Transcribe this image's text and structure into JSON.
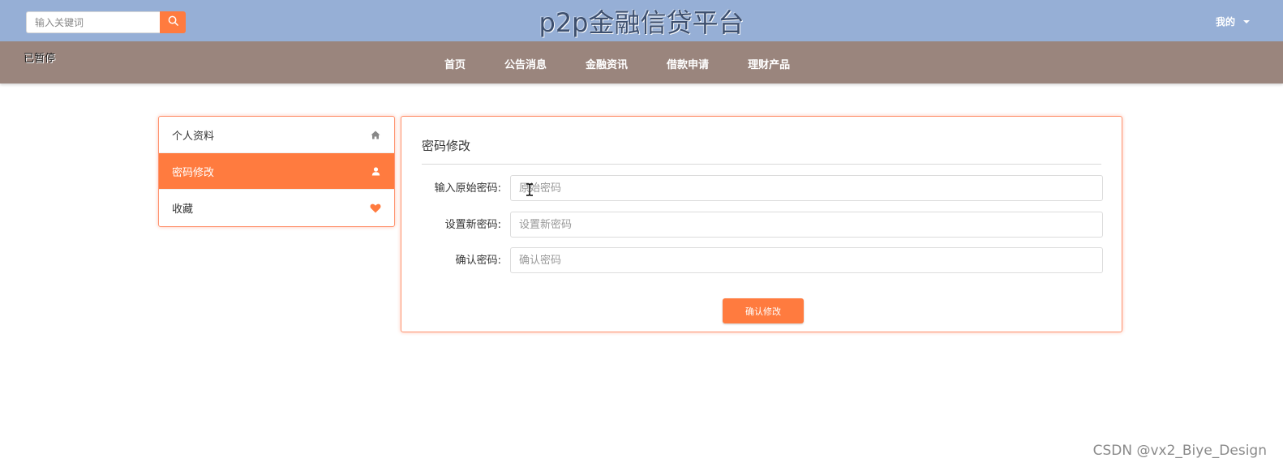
{
  "header": {
    "search_placeholder": "输入关键词",
    "site_title": "p2p金融信贷平台",
    "user_menu_label": "我的"
  },
  "navbar": {
    "paused_label": "已暂停",
    "items": [
      {
        "label": "首页"
      },
      {
        "label": "公告消息"
      },
      {
        "label": "金融资讯"
      },
      {
        "label": "借款申请"
      },
      {
        "label": "理财产品"
      }
    ]
  },
  "sidemenu": {
    "items": [
      {
        "label": "个人资料",
        "icon": "home-icon",
        "active": false
      },
      {
        "label": "密码修改",
        "icon": "user-icon",
        "active": true
      },
      {
        "label": "收藏",
        "icon": "heart-icon",
        "active": false
      }
    ]
  },
  "password_form": {
    "title": "密码修改",
    "fields": [
      {
        "label": "输入原始密码:",
        "placeholder": "原始密码",
        "value": ""
      },
      {
        "label": "设置新密码:",
        "placeholder": "设置新密码",
        "value": ""
      },
      {
        "label": "确认密码:",
        "placeholder": "确认密码",
        "value": ""
      }
    ],
    "submit_label": "确认修改"
  },
  "watermark": "CSDN @vx2_Biye_Design",
  "colors": {
    "header_bg": "#96afd6",
    "navbar_bg": "#9a857d",
    "accent": "#ff7b3f"
  }
}
